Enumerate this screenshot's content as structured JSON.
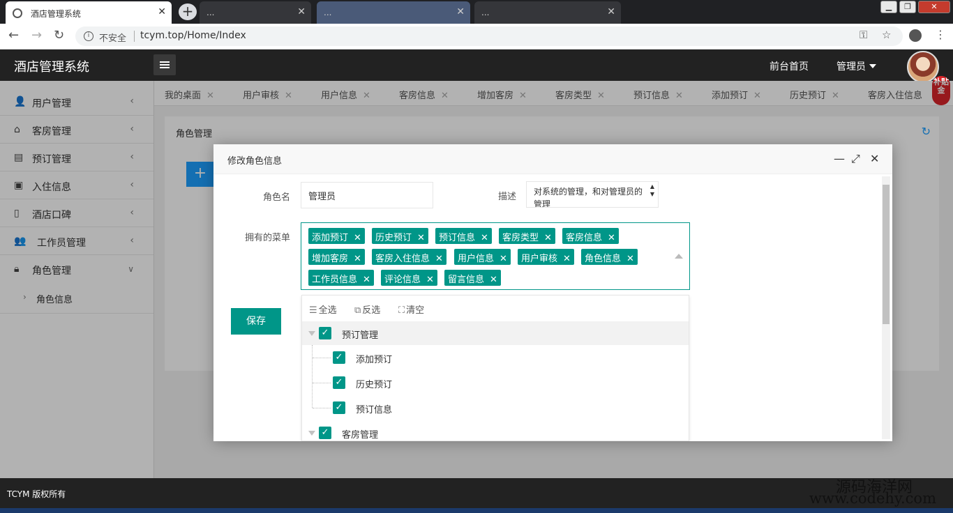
{
  "browser": {
    "tabs": [
      {
        "title": "酒店管理系统",
        "active": true
      },
      {
        "title": "..."
      },
      {
        "title": "..."
      },
      {
        "title": "..."
      }
    ],
    "insecure_label": "不安全",
    "url": "tcym.top/Home/Index"
  },
  "header": {
    "title": "酒店管理系统",
    "front_home": "前台首页",
    "admin": "管理员",
    "badge": "补贴金"
  },
  "sidebar": {
    "items": [
      {
        "label": "用户管理",
        "icon": "user-icon"
      },
      {
        "label": "客房管理",
        "icon": "home-icon"
      },
      {
        "label": "预订管理",
        "icon": "clipboard-icon"
      },
      {
        "label": "入住信息",
        "icon": "monitor-icon"
      },
      {
        "label": "酒店口碑",
        "icon": "document-icon"
      },
      {
        "label": "工作员管理",
        "icon": "group-icon"
      },
      {
        "label": "角色管理",
        "icon": "lock-icon",
        "expanded": true
      }
    ],
    "sub_items": [
      {
        "label": "角色信息"
      }
    ]
  },
  "page_tabs": [
    "我的桌面",
    "用户审核",
    "用户信息",
    "客房信息",
    "增加客房",
    "客房类型",
    "预订信息",
    "添加预订",
    "历史预订",
    "客房入住信息"
  ],
  "main": {
    "panel_title": "角色管理",
    "add_label": "+"
  },
  "modal": {
    "title": "修改角色信息",
    "role_name_label": "角色名",
    "role_name_value": "管理员",
    "desc_label": "描述",
    "desc_value": "对系统的管理，和对管理员的管理",
    "menus_label": "拥有的菜单",
    "chips": [
      "添加预订",
      "历史预订",
      "预订信息",
      "客房类型",
      "客房信息",
      "增加客房",
      "客房入住信息",
      "用户信息",
      "用户审核",
      "角色信息",
      "工作员信息",
      "评论信息",
      "留言信息"
    ],
    "save_label": "保存",
    "tools": {
      "select_all": "全选",
      "invert": "反选",
      "clear": "清空"
    },
    "tree": [
      {
        "label": "预订管理",
        "level": 0,
        "checked": true
      },
      {
        "label": "添加预订",
        "level": 1,
        "checked": true
      },
      {
        "label": "历史预订",
        "level": 1,
        "checked": true
      },
      {
        "label": "预订信息",
        "level": 1,
        "checked": true
      },
      {
        "label": "客房管理",
        "level": 0,
        "checked": true
      }
    ]
  },
  "footer": {
    "text": "TCYM 版权所有",
    "watermark_cn": "源码海洋网",
    "watermark_url": "www.codehy.com"
  },
  "colors": {
    "accent": "#009688",
    "header_bg": "#222222",
    "blue": "#1e9fff"
  }
}
